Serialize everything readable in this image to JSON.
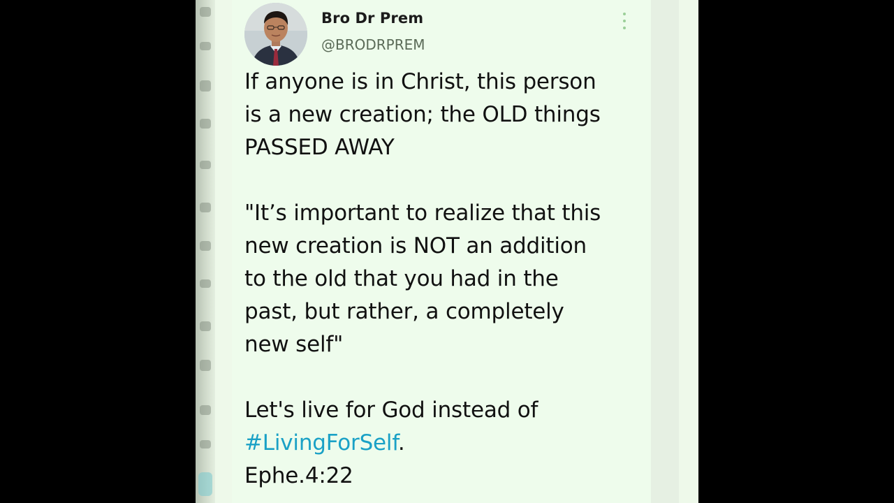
{
  "tweet": {
    "author_name": "Bro Dr Prem",
    "author_handle": "@BRODRPREM",
    "avatar_icon": "profile-photo-icon",
    "more_icon": "vertical-dots-icon",
    "lines": [
      "If anyone is in Christ, this person",
      "is a new creation; the OLD things",
      "PASSED AWAY",
      "\"It’s important to realize that this",
      "new creation is NOT an addition",
      "to the old that you had in the",
      "past, but rather, a completely",
      "new self\"",
      "Let's live for God instead of"
    ],
    "hashtag": "#LivingForSelf",
    "hashtag_suffix": ".",
    "reference": "Ephe.4:22"
  },
  "colors": {
    "background_frame": "#000000",
    "card_background": "#eefcec",
    "text": "#111111",
    "handle": "#5b6b58",
    "hashtag": "#1aa1c6",
    "more_dots": "#9bcf98"
  }
}
